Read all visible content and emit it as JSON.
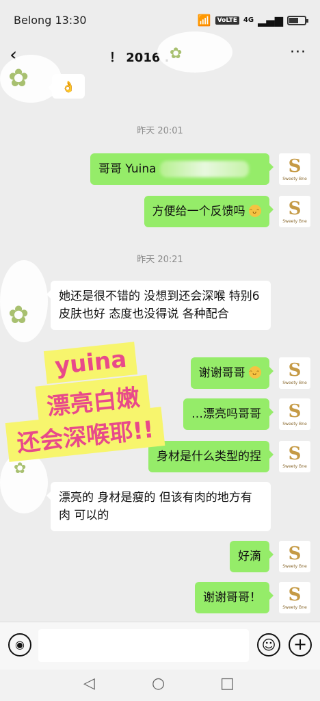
{
  "status": {
    "carrier_time": "Belong 13:30",
    "network": "4G",
    "volte": "VoLTE"
  },
  "header": {
    "title": "！ 2016 ."
  },
  "messages": [
    {
      "time": "昨天 20:01"
    },
    {
      "me1": "哥哥 Yuina"
    },
    {
      "me2": "方便给一个反馈吗"
    },
    {
      "time": "昨天 20:21"
    }
  ],
  "chat": {
    "time1": "昨天 20:01",
    "time2": "昨天 20:21",
    "msg_me_1": "哥哥 Yuina",
    "msg_me_2": "方便给一个反馈吗",
    "msg_other_1": "她还是很不错的 没想到还会深喉 特别6 皮肤也好 态度也没得说 各种配合",
    "msg_me_3": "谢谢哥哥",
    "msg_me_4": "…漂亮吗哥哥",
    "msg_me_5": "身材是什么类型的捏",
    "msg_other_2": "漂亮的 身材是瘦的 但该有肉的地方有肉 可以的",
    "msg_me_6": "好滴",
    "msg_me_7": "谢谢哥哥！",
    "avatar_brand": "Sweety Bne",
    "avatar_mono": "S"
  },
  "overlay": {
    "line1": "yuina",
    "line2": "漂亮白嫩",
    "line3": "还会深喉耶!!"
  },
  "input": {
    "placeholder": ""
  },
  "colors": {
    "my_bubble": "#95ec69",
    "other_bubble": "#ffffff",
    "overlay_text": "#e84a8a",
    "overlay_bg": "#f7f56d"
  }
}
